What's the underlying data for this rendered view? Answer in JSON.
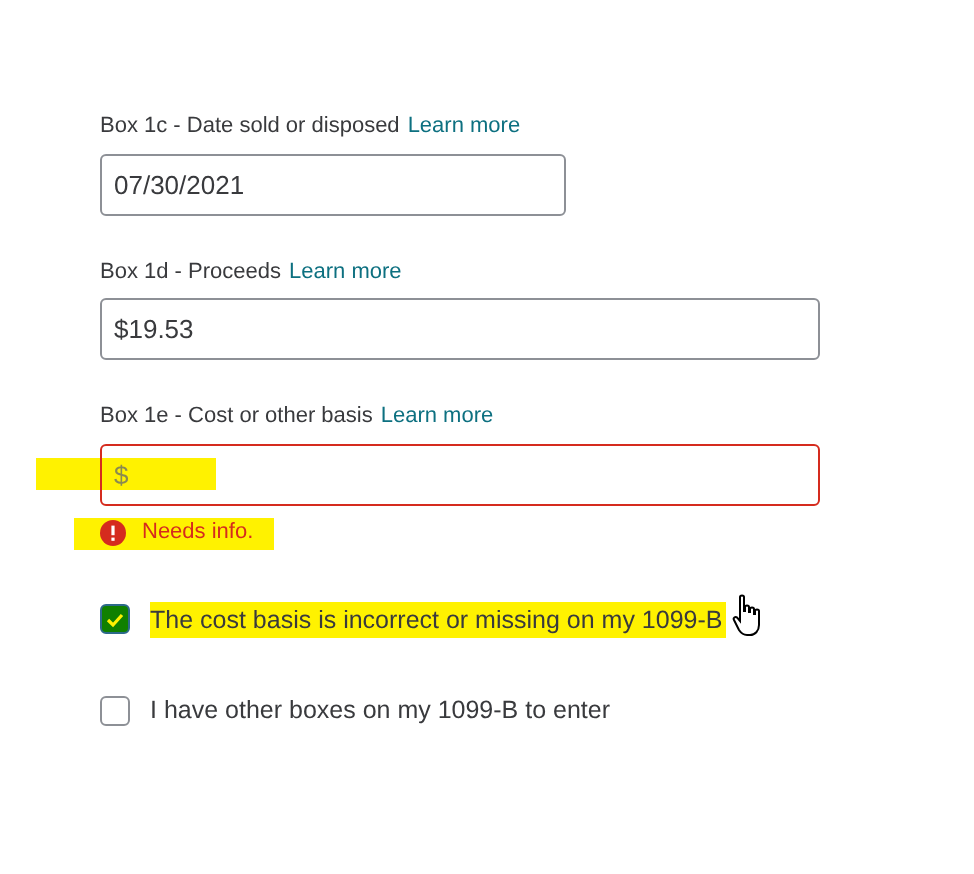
{
  "fields": [
    {
      "label": "Box 1c - Date sold or disposed",
      "link": "Learn more",
      "value": "07/30/2021",
      "wide": false,
      "error": false
    },
    {
      "label": "Box 1d - Proceeds",
      "link": "Learn more",
      "value": "$19.53",
      "wide": true,
      "error": false
    },
    {
      "label": "Box 1e - Cost or other basis",
      "link": "Learn more",
      "placeholder": "$",
      "wide": true,
      "error": true,
      "error_message": "Needs info."
    }
  ],
  "checkboxes": [
    {
      "label": "The cost basis is incorrect or missing on my 1099-B",
      "checked": true
    },
    {
      "label": "I have other boxes on my 1099-B to enter",
      "checked": false
    }
  ]
}
